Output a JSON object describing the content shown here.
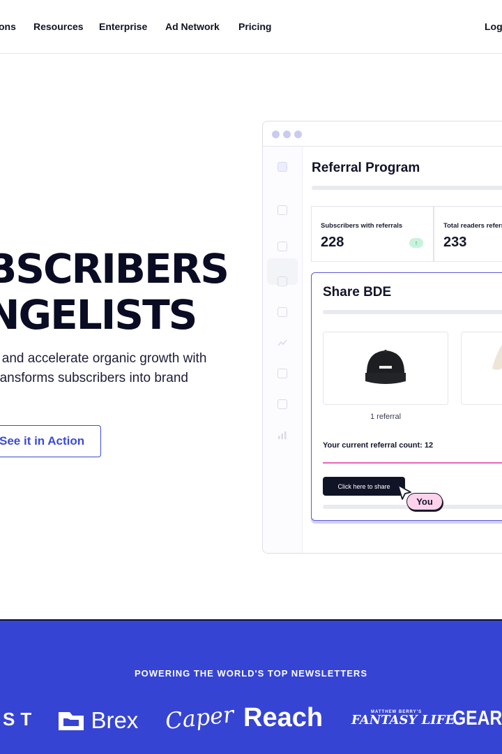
{
  "nav": {
    "items": [
      "ons",
      "Resources",
      "Enterprise",
      "Ad Network",
      "Pricing"
    ],
    "login": "Log"
  },
  "hero": {
    "headline_1": "BSCRIBERS",
    "headline_2": "NGELISTS",
    "subtext_1": "s and accelerate organic growth with",
    "subtext_2": "transforms subscribers into brand",
    "cta": "See it in Action"
  },
  "mock": {
    "title": "Referral Program",
    "stats": [
      {
        "label": "Subscribers with referrals",
        "value": "228",
        "trend": "↑"
      },
      {
        "label": "Total readers referre",
        "value": "233"
      }
    ],
    "share": {
      "title": "Share BDE",
      "referral_label": "1 referral",
      "current_count": "Your current referral count: 12",
      "share_button": "Click here to share",
      "you_label": "You"
    },
    "colors": {
      "accent": "#5b57d6",
      "pink": "#ea63b6",
      "dots": "#c9cbf0"
    }
  },
  "band": {
    "caption": "POWERING THE WORLD'S TOP NEWSLETTERS",
    "logos": [
      "ST",
      "Brex",
      "Caper",
      "Reach",
      "MATTHEW BERRY'S",
      "FANTASY LIFE",
      "GEAR"
    ],
    "color": "#3644d4"
  }
}
